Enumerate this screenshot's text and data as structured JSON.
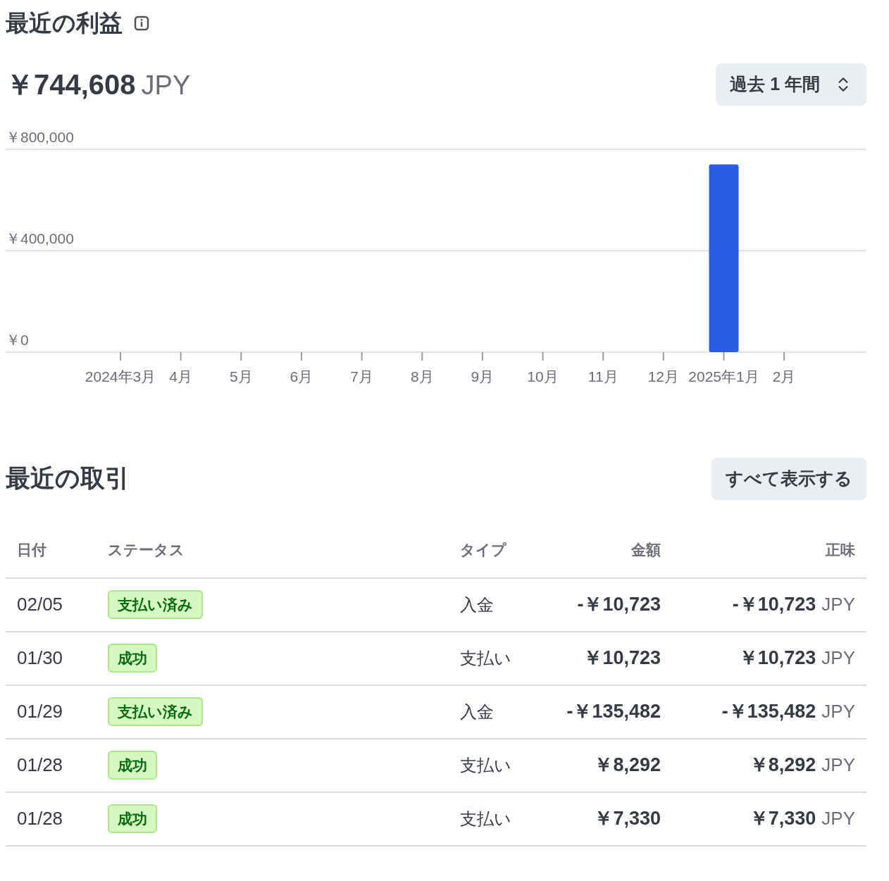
{
  "earnings": {
    "title": "最近の利益",
    "amount": "￥744,608",
    "currency": "JPY",
    "range": "過去 1 年間",
    "chart_data": {
      "type": "bar",
      "categories": [
        "2024年3月",
        "4月",
        "5月",
        "6月",
        "7月",
        "8月",
        "9月",
        "10月",
        "11月",
        "12月",
        "2025年1月",
        "2月"
      ],
      "series": [
        {
          "color": "#2a5ce6",
          "values": [
            0,
            0,
            0,
            0,
            0,
            0,
            0,
            0,
            0,
            0,
            740000,
            0
          ]
        }
      ],
      "ylim": [
        0,
        800000
      ],
      "yticks": [
        {
          "value": 0,
          "label": "￥0"
        },
        {
          "value": 400000,
          "label": "￥400,000"
        },
        {
          "value": 800000,
          "label": "￥800,000"
        }
      ]
    }
  },
  "transactions": {
    "title": "最近の取引",
    "view_all": "すべて表示する",
    "columns": [
      "日付",
      "ステータス",
      "タイプ",
      "金額",
      "正味"
    ],
    "rows": [
      {
        "date": "02/05",
        "status": "支払い済み",
        "type": "入金",
        "amount": "-￥10,723",
        "net": "-￥10,723",
        "currency": "JPY"
      },
      {
        "date": "01/30",
        "status": "成功",
        "type": "支払い",
        "amount": "￥10,723",
        "net": "￥10,723",
        "currency": "JPY"
      },
      {
        "date": "01/29",
        "status": "支払い済み",
        "type": "入金",
        "amount": "-￥135,482",
        "net": "-￥135,482",
        "currency": "JPY"
      },
      {
        "date": "01/28",
        "status": "成功",
        "type": "支払い",
        "amount": "￥8,292",
        "net": "￥8,292",
        "currency": "JPY"
      },
      {
        "date": "01/28",
        "status": "成功",
        "type": "支払い",
        "amount": "￥7,330",
        "net": "￥7,330",
        "currency": "JPY"
      }
    ]
  }
}
